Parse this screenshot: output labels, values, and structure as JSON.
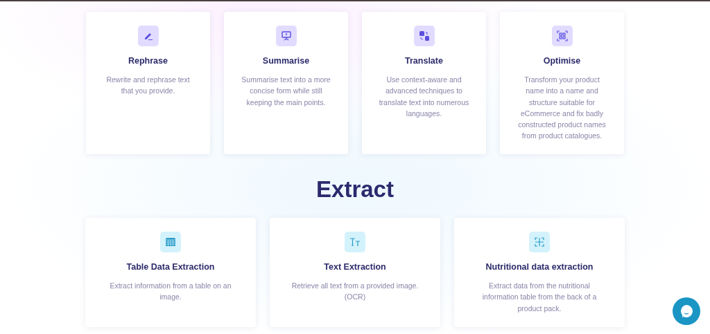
{
  "top_cards": [
    {
      "title": "Rephrase",
      "description": "Rewrite and rephrase text that you provide."
    },
    {
      "title": "Summarise",
      "description": "Summarise text into a more concise form while still keeping the main points."
    },
    {
      "title": "Translate",
      "description": "Use context-aware and advanced techniques to translate text into numerous languages."
    },
    {
      "title": "Optimise",
      "description": "Transform your product name into a name and structure suitable for eCommerce and fix badly constructed product names from product catalogues."
    }
  ],
  "section_heading": "Extract",
  "extract_cards": [
    {
      "title": "Table Data Extraction",
      "description": "Extract information from a table on an image."
    },
    {
      "title": "Text Extraction",
      "description": "Retrieve all text from a provided image. (OCR)"
    },
    {
      "title": "Nutritional data extraction",
      "description": "Extract data from the nutritional information table from the back of a product pack."
    }
  ]
}
